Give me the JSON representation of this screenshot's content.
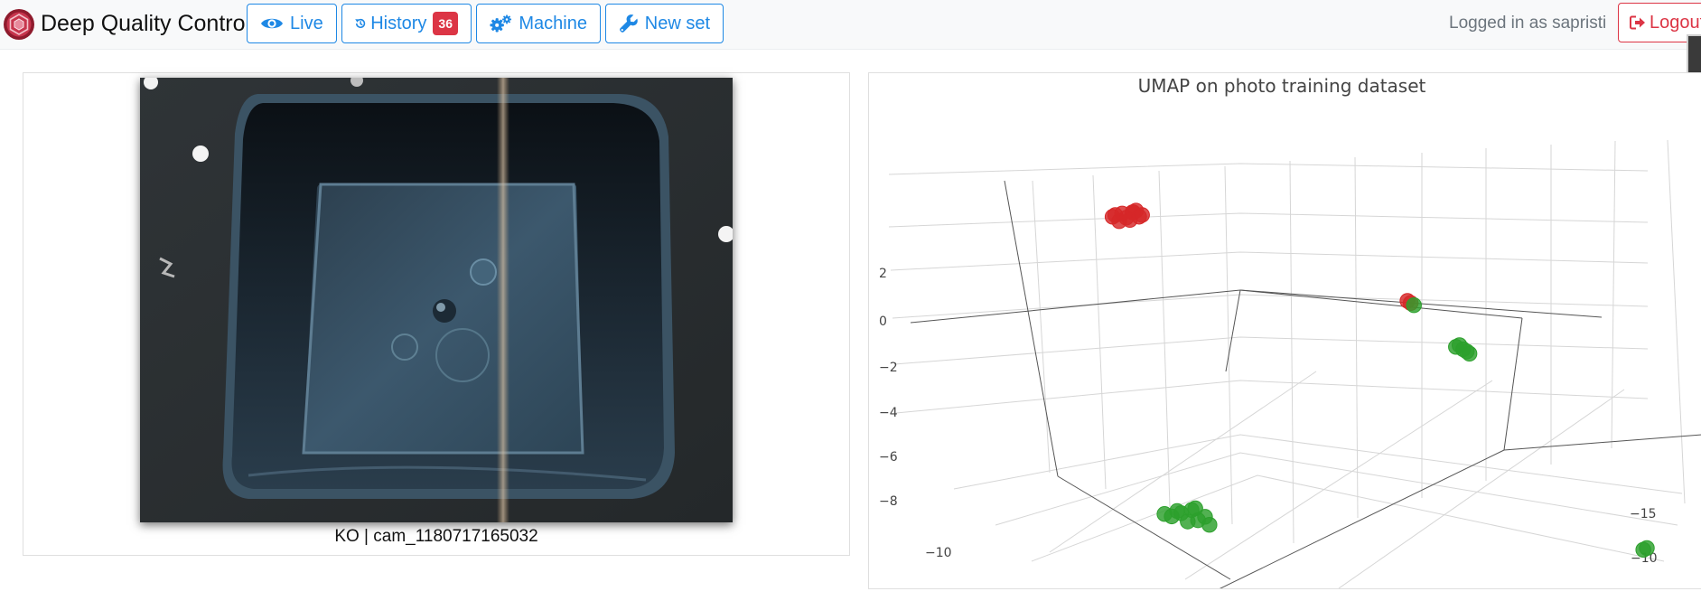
{
  "navbar": {
    "brand": "Deep Quality Control",
    "buttons": {
      "live": "Live",
      "history": "History",
      "history_count": "36",
      "machine": "Machine",
      "new_set": "New set"
    },
    "login_text": "Logged in as sapristi",
    "logout": "Logout",
    "colors": {
      "accent": "#1e88e5",
      "danger": "#dc3545"
    }
  },
  "main": {
    "image_caption": "KO | cam_1180717165032"
  },
  "chart_data": {
    "type": "scatter",
    "subtype": "scatter3d",
    "title": "UMAP on photo training dataset",
    "axis_ticks": {
      "z": [
        "2",
        "0",
        "−2",
        "−4",
        "−6",
        "−8"
      ],
      "x": [
        "−10"
      ],
      "y": [
        "−15",
        "−10"
      ]
    },
    "grid": true,
    "series": [
      {
        "color": "#d62728",
        "points": [
          [
            -10.4,
            -17.3,
            3.4
          ],
          [
            -10.1,
            -17.2,
            3.5
          ],
          [
            -10.3,
            -17.0,
            3.2
          ],
          [
            -10.6,
            -17.4,
            3.3
          ],
          [
            -10.0,
            -17.1,
            3.6
          ],
          [
            -10.2,
            -16.9,
            3.1
          ],
          [
            -10.5,
            -17.2,
            3.0
          ],
          [
            -9.8,
            -17.5,
            3.4
          ],
          [
            -10.7,
            -17.1,
            3.2
          ],
          [
            -10.1,
            -16.8,
            3.5
          ],
          [
            -9.9,
            -17.3,
            3.3
          ],
          [
            -2.2,
            -14.1,
            -0.1
          ],
          [
            -2.1,
            -14.2,
            -0.2
          ]
        ]
      },
      {
        "color": "#2ca02c",
        "points": [
          [
            -2.0,
            -14.3,
            -0.3
          ],
          [
            -0.6,
            -13.9,
            -2.4
          ],
          [
            -0.7,
            -14.0,
            -2.2
          ],
          [
            -0.5,
            -13.8,
            -2.5
          ],
          [
            -0.8,
            -14.1,
            -2.3
          ],
          [
            -0.4,
            -14.2,
            -2.6
          ],
          [
            -9.4,
            -8.8,
            -11.9
          ],
          [
            -9.1,
            -8.6,
            -11.7
          ],
          [
            -9.7,
            -8.5,
            -12.1
          ],
          [
            -8.9,
            -8.9,
            -12.2
          ],
          [
            -9.5,
            -9.1,
            -11.8
          ],
          [
            -8.7,
            -8.7,
            -12.0
          ],
          [
            -9.2,
            -9.0,
            -12.3
          ],
          [
            -9.9,
            -8.7,
            -12.0
          ],
          [
            -9.0,
            -8.4,
            -11.6
          ],
          [
            -8.6,
            -8.3,
            -12.4
          ],
          [
            4.5,
            -12.6,
            -12.1
          ],
          [
            4.6,
            -12.5,
            -12.0
          ]
        ]
      }
    ]
  }
}
